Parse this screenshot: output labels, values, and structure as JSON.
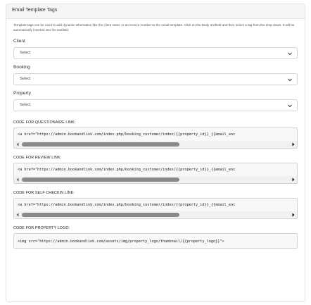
{
  "panel": {
    "title": "Email Template Tags",
    "description": "Template tags can be used to add dynamic information like the client name or an invoice number to the email template. Click on the Body textfield and then select a tag from the drop down. It will be automatically inserted into the textfield."
  },
  "fields": [
    {
      "label": "Client",
      "selected": "Select"
    },
    {
      "label": "Booking",
      "selected": "Select"
    },
    {
      "label": "Property",
      "selected": "Select"
    }
  ],
  "codes": [
    {
      "label": "CODE FOR QUESTIONAIRE LINK:",
      "code": "<a href=\"https://admin.bookandlink.com/index.php/booking_customer/index/{{property_id}}_{{email_enc",
      "scroll_fraction": 0.59
    },
    {
      "label": "CODE FOR REVIEW LINK:",
      "code": "<a href=\"https://admin.bookandlink.com/index.php/booking_customer/index/{{property_id}}_{{email_enc",
      "scroll_fraction": 0.59
    },
    {
      "label": "CODE FOR SELF CHECKIN LINK:",
      "code": "<a href=\"https://admin.bookandlink.com/index.php/booking_customer/index/{{property_id}}_{{email_enc",
      "scroll_fraction": 0.59
    }
  ],
  "logo_code": {
    "label": "CODE FOR PROPERTY LOGO:",
    "code": "<img src=\"https://admin.bookandlink.com/assets/img/property_logo/thumbnail/{{property_logo}}\">"
  },
  "icons": {
    "select_chevron": "chevron-down-icon",
    "scroll_left": "triangle-left-icon",
    "scroll_right": "triangle-right-icon"
  }
}
